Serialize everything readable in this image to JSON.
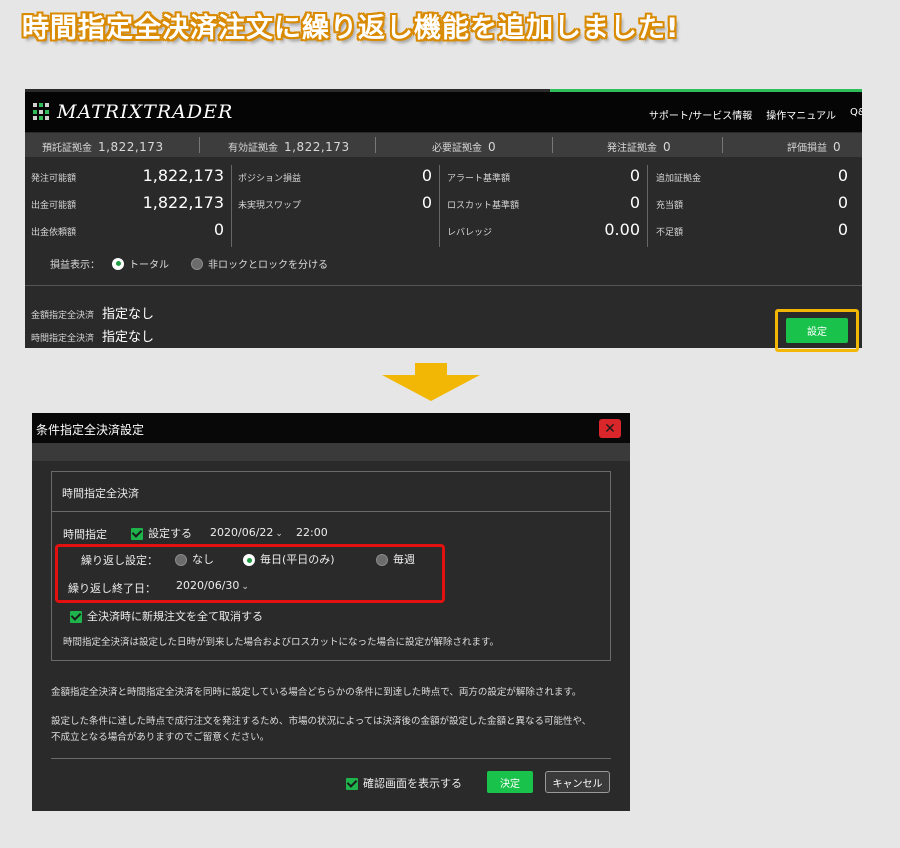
{
  "headline": "時間指定全決済注文に繰り返し機能を追加しました!",
  "app": {
    "logo": "MATRIXTRADER",
    "header_links": [
      "サポート/サービス情報",
      "操作マニュアル",
      "Q&"
    ],
    "summary": [
      {
        "label": "預託証拠金",
        "value": "1,822,173"
      },
      {
        "label": "有効証拠金",
        "value": "1,822,173"
      },
      {
        "label": "必要証拠金",
        "value": "0"
      },
      {
        "label": "発注証拠金",
        "value": "0"
      },
      {
        "label": "評価損益",
        "value": "0"
      }
    ],
    "grid": {
      "col1": [
        {
          "label": "発注可能額",
          "value": "1,822,173"
        },
        {
          "label": "出金可能額",
          "value": "1,822,173"
        },
        {
          "label": "出金依頼額",
          "value": "0"
        }
      ],
      "col2": [
        {
          "label": "ポジション損益",
          "value": "0"
        },
        {
          "label": "未実現スワップ",
          "value": "0"
        }
      ],
      "col3": [
        {
          "label": "アラート基準額",
          "value": "0"
        },
        {
          "label": "ロスカット基準額",
          "value": "0"
        },
        {
          "label": "レバレッジ",
          "value": "0.00"
        }
      ],
      "col4": [
        {
          "label": "追加証拠金",
          "value": "0"
        },
        {
          "label": "充当額",
          "value": "0"
        },
        {
          "label": "不足額",
          "value": "0"
        }
      ]
    },
    "pl_display": {
      "label": "損益表示：",
      "option_total": "トータル",
      "option_split": "非ロックとロックを分ける"
    },
    "amount_settle": {
      "label": "金額指定全決済",
      "value": "指定なし"
    },
    "time_settle": {
      "label": "時間指定全決済",
      "value": "指定なし"
    },
    "set_button": "設定"
  },
  "dialog": {
    "title": "条件指定全決済設定",
    "group_title": "時間指定全決済",
    "time_label": "時間指定",
    "set_check": "設定する",
    "date": "2020/06/22",
    "time": "22:00",
    "repeat_label": "繰り返し設定：",
    "repeat_none": "なし",
    "repeat_daily": "毎日(平日のみ)",
    "repeat_weekly": "毎週",
    "repeat_end_label": "繰り返し終了日：",
    "repeat_end_date": "2020/06/30",
    "cancel_new_orders": "全決済時に新規注文を全て取消する",
    "note_group": "時間指定全決済は設定した日時が到来した場合およびロスカットになった場合に設定が解除されます。",
    "note1": "金額指定全決済と時間指定全決済を同時に設定している場合どちらかの条件に到達した時点で、両方の設定が解除されます。",
    "note2_line1": "設定した条件に達した時点で成行注文を発注するため、市場の状況によっては決済後の金額が設定した金額と異なる可能性や、",
    "note2_line2": "不成立となる場合がありますのでご留意ください。",
    "confirm_check": "確認画面を表示する",
    "ok_button": "決定",
    "cancel_button": "キャンセル",
    "close_glyph": "✕"
  },
  "colors": {
    "accent_green": "#19c24a",
    "highlight_yellow": "#f2b705",
    "highlight_red": "#e31010"
  }
}
